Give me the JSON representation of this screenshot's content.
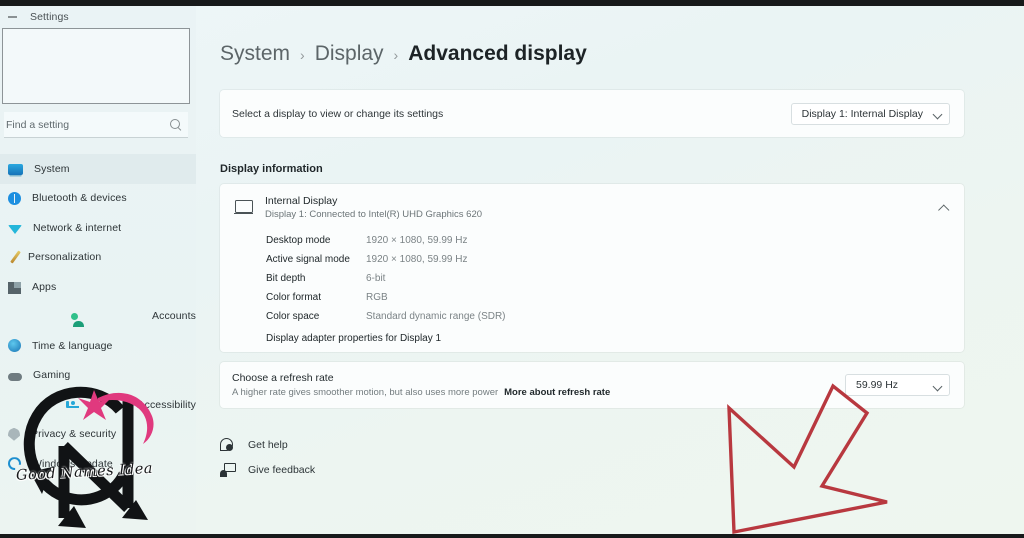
{
  "window": {
    "title": "Settings",
    "back_icon": "back-arrow-icon"
  },
  "search": {
    "placeholder": "Find a setting",
    "value": "",
    "icon": "search-icon"
  },
  "sidebar": {
    "items": [
      {
        "label": "System",
        "icon": "display-monitor-icon",
        "selected": true
      },
      {
        "label": "Bluetooth & devices",
        "icon": "bluetooth-icon",
        "selected": false
      },
      {
        "label": "Network & internet",
        "icon": "wifi-icon",
        "selected": false
      },
      {
        "label": "Personalization",
        "icon": "paintbrush-icon",
        "selected": false
      },
      {
        "label": "Apps",
        "icon": "apps-grid-icon",
        "selected": false
      },
      {
        "label": "Accounts",
        "icon": "person-icon",
        "selected": false
      },
      {
        "label": "Time & language",
        "icon": "globe-clock-icon",
        "selected": false
      },
      {
        "label": "Gaming",
        "icon": "gamepad-icon",
        "selected": false
      },
      {
        "label": "Accessibility",
        "icon": "accessibility-icon",
        "selected": false
      },
      {
        "label": "Privacy & security",
        "icon": "shield-icon",
        "selected": false
      },
      {
        "label": "Windows Update",
        "icon": "update-refresh-icon",
        "selected": false
      }
    ]
  },
  "breadcrumb": {
    "items": [
      "System",
      "Display",
      "Advanced display"
    ],
    "separator": "›"
  },
  "display_selector": {
    "label": "Select a display to view or change its settings",
    "dropdown_value": "Display 1: Internal Display",
    "chevron": "chevron-down-icon"
  },
  "display_information": {
    "section_title": "Display information",
    "device_name": "Internal Display",
    "device_sub": "Display 1: Connected to Intel(R) UHD Graphics 620",
    "device_icon": "monitor-icon",
    "expand_chevron": "chevron-up-icon",
    "specs": [
      {
        "key": "Desktop mode",
        "value": "1920 × 1080, 59.99 Hz"
      },
      {
        "key": "Active signal mode",
        "value": "1920 × 1080, 59.99 Hz"
      },
      {
        "key": "Bit depth",
        "value": "6-bit"
      },
      {
        "key": "Color format",
        "value": "RGB"
      },
      {
        "key": "Color space",
        "value": "Standard dynamic range (SDR)"
      }
    ],
    "adapter_link": "Display adapter properties for Display 1"
  },
  "refresh_rate": {
    "title": "Choose a refresh rate",
    "description": "A higher rate gives smoother motion, but also uses more power",
    "link": "More about refresh rate",
    "dropdown_value": "59.99 Hz",
    "chevron": "chevron-down-icon"
  },
  "footer": {
    "links": [
      {
        "label": "Get help",
        "icon": "help-question-icon"
      },
      {
        "label": "Give feedback",
        "icon": "feedback-person-icon"
      }
    ]
  },
  "annotation": {
    "arrow_color": "#b8383f",
    "arrow_points_to": "refresh-rate-dropdown"
  },
  "watermark": {
    "text": "Good Names Idea",
    "monogram": "GN"
  }
}
